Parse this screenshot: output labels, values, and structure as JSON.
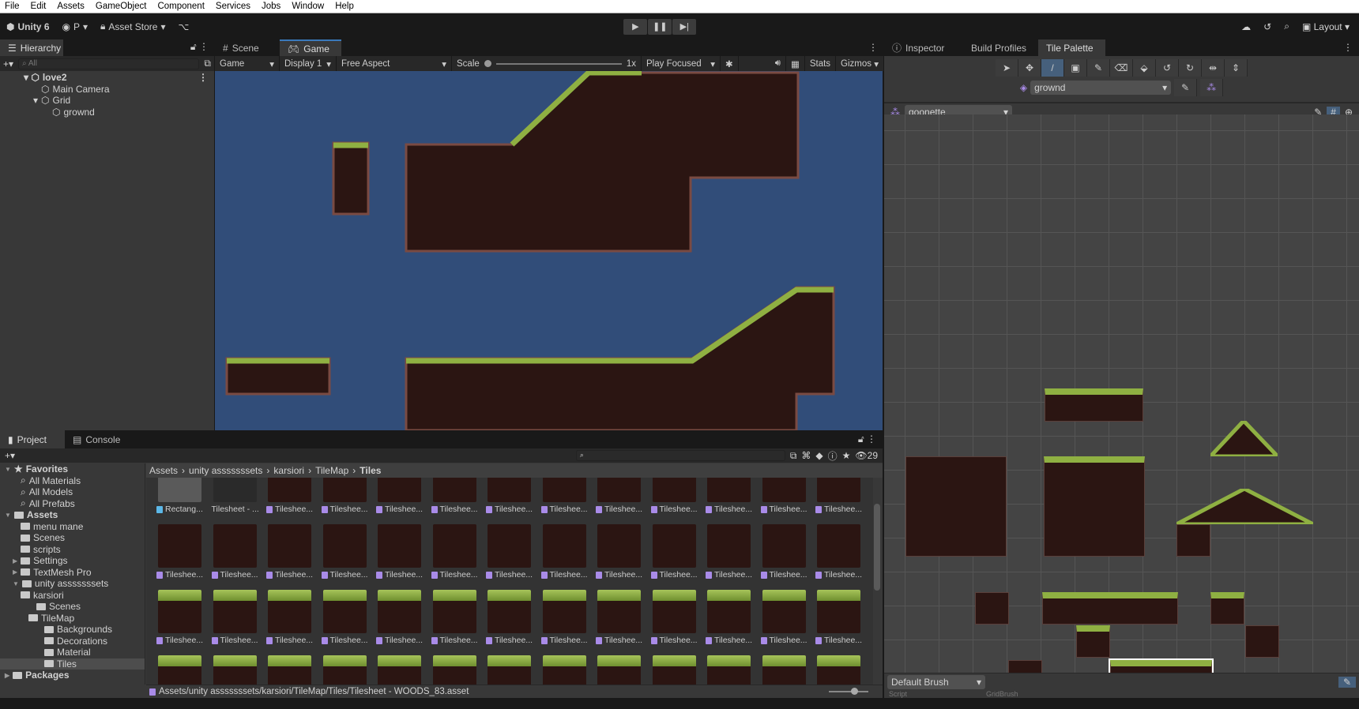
{
  "menu": [
    "File",
    "Edit",
    "Assets",
    "GameObject",
    "Component",
    "Services",
    "Jobs",
    "Window",
    "Help"
  ],
  "toolbar": {
    "unity": "Unity 6",
    "account": "P",
    "asset_store": "Asset Store",
    "layout": "Layout"
  },
  "hierarchy": {
    "tab": "Hierarchy",
    "search_placeholder": "All",
    "items": [
      "love2",
      "Main Camera",
      "Grid",
      "grownd"
    ]
  },
  "scene_tabs": {
    "scene": "Scene",
    "game": "Game"
  },
  "game_toolbar": {
    "view": "Game",
    "display": "Display 1",
    "aspect": "Free Aspect",
    "scale_label": "Scale",
    "scale_value": "1x",
    "play_mode": "Play Focused",
    "stats": "Stats",
    "gizmos": "Gizmos"
  },
  "right_tabs": {
    "inspector": "Inspector",
    "build": "Build Profiles",
    "palette": "Tile Palette"
  },
  "tile_palette": {
    "tilemap": "grownd",
    "palette": "goonette",
    "brush": "Default Brush",
    "script_label": "Script",
    "script_value": "GridBrush"
  },
  "project": {
    "tab": "Project",
    "console": "Console",
    "count": "29",
    "breadcrumb": [
      "Assets",
      "unity asssssssets",
      "karsiori",
      "TileMap",
      "Tiles"
    ],
    "tree": [
      {
        "label": "Favorites",
        "depth": 0,
        "type": "star"
      },
      {
        "label": "All Materials",
        "depth": 2,
        "type": "search"
      },
      {
        "label": "All Models",
        "depth": 2,
        "type": "search"
      },
      {
        "label": "All Prefabs",
        "depth": 2,
        "type": "search"
      },
      {
        "label": "Assets",
        "depth": 0,
        "type": "folder"
      },
      {
        "label": "menu mane",
        "depth": 2,
        "type": "folder"
      },
      {
        "label": "Scenes",
        "depth": 2,
        "type": "folder"
      },
      {
        "label": "scripts",
        "depth": 2,
        "type": "folder"
      },
      {
        "label": "Settings",
        "depth": 1,
        "type": "folder"
      },
      {
        "label": "TextMesh Pro",
        "depth": 1,
        "type": "folder"
      },
      {
        "label": "unity asssssssets",
        "depth": 1,
        "type": "folder"
      },
      {
        "label": "karsiori",
        "depth": 2,
        "type": "folder"
      },
      {
        "label": "Scenes",
        "depth": 4,
        "type": "folder"
      },
      {
        "label": "TileMap",
        "depth": 3,
        "type": "folder"
      },
      {
        "label": "Backgrounds",
        "depth": 5,
        "type": "folder"
      },
      {
        "label": "Decorations",
        "depth": 5,
        "type": "folder"
      },
      {
        "label": "Material",
        "depth": 5,
        "type": "folder"
      },
      {
        "label": "Tiles",
        "depth": 5,
        "type": "folder"
      },
      {
        "label": "Packages",
        "depth": 0,
        "type": "folder"
      }
    ],
    "row0_labels": [
      "Rectang...",
      "Tilesheet - ...",
      "Tileshee...",
      "Tileshee...",
      "Tileshee...",
      "Tileshee...",
      "Tileshee...",
      "Tileshee...",
      "Tileshee...",
      "Tileshee...",
      "Tileshee...",
      "Tileshee...",
      "Tileshee..."
    ],
    "item_label": "Tileshee...",
    "selected_path": "Assets/unity asssssssets/karsiori/TileMap/Tiles/Tilesheet - WOODS_83.asset"
  },
  "colors": {
    "game_bg": "#314d79",
    "dirt": "#2b1512",
    "grass": "#8fb042",
    "accent": "#3a79bb"
  }
}
